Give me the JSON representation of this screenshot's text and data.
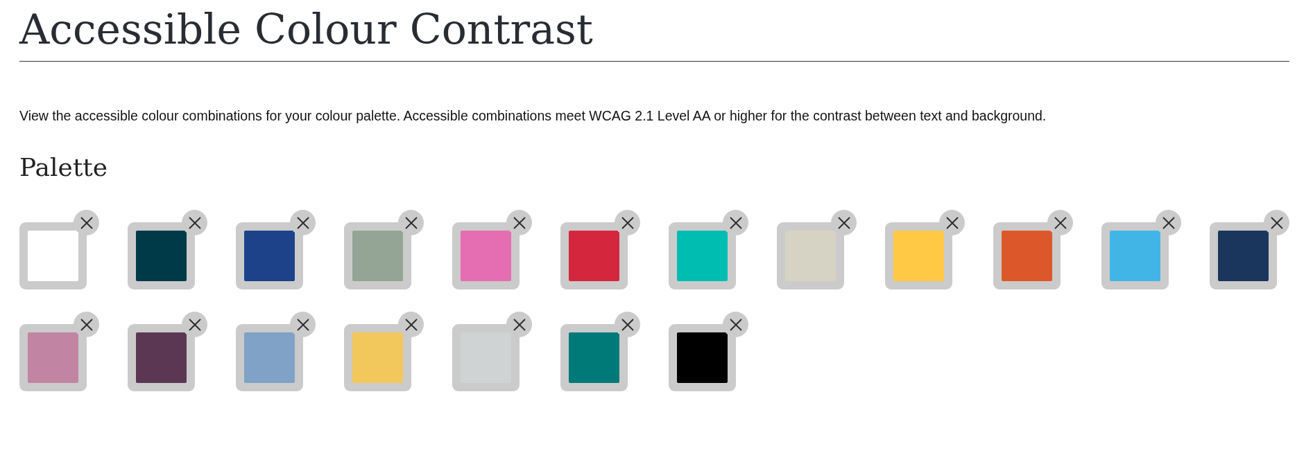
{
  "title": "Accessible Colour Contrast",
  "intro": "View the accessible colour combinations for your colour palette. Accessible combinations meet WCAG 2.1 Level AA or higher for the contrast between text and background.",
  "palette": {
    "heading": "Palette",
    "colors": [
      {
        "color": "#ffffff"
      },
      {
        "color": "#003a48"
      },
      {
        "color": "#1d428a"
      },
      {
        "color": "#94a596"
      },
      {
        "color": "#e56db1"
      },
      {
        "color": "#d4273e"
      },
      {
        "color": "#00bdb2"
      },
      {
        "color": "#d6d2c4"
      },
      {
        "color": "#ffc845"
      },
      {
        "color": "#dc582a"
      },
      {
        "color": "#41b6e6"
      },
      {
        "color": "#1b365d"
      },
      {
        "color": "#c185a3"
      },
      {
        "color": "#5c3754"
      },
      {
        "color": "#7fa2c6"
      },
      {
        "color": "#f2c75c"
      },
      {
        "color": "#d0d3d4"
      },
      {
        "color": "#007a78"
      },
      {
        "color": "#000000"
      }
    ]
  }
}
